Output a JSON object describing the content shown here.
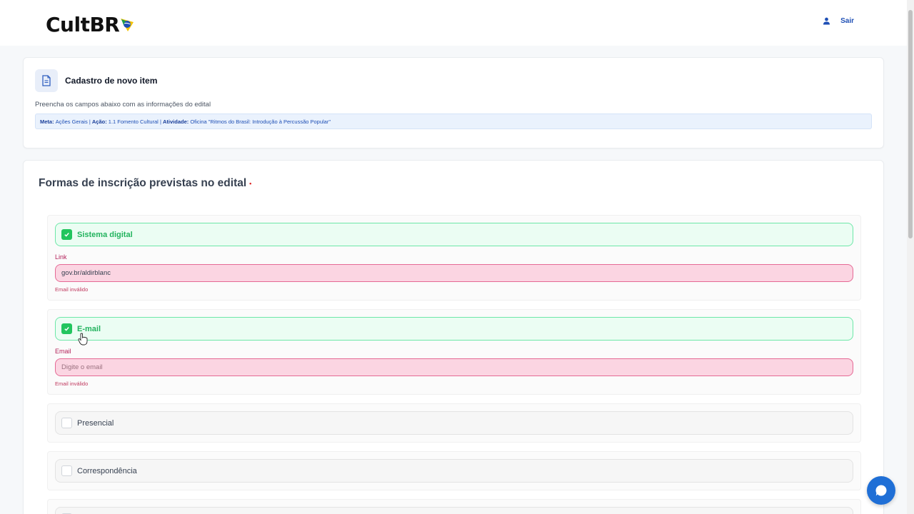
{
  "app": {
    "logo_text": "CultBR",
    "logout_label": "Sair",
    "colors": {
      "brand_blue": "#1e4fb5",
      "success_green": "#22c55e",
      "error_pink": "#e56a95"
    }
  },
  "header_card": {
    "title": "Cadastro de novo item",
    "description": "Preencha os campos abaixo com as informações do edital",
    "meta": {
      "meta_label": "Meta:",
      "meta_value": "Ações Gerais",
      "acao_label": "Ação:",
      "acao_value": "1.1 Fomento Cultural",
      "atividade_label": "Atividade:",
      "atividade_value": "Oficina \"Ritmos do Brasil: Introdução à Percussão Popular\"",
      "separator": "|"
    }
  },
  "form": {
    "section_title": "Formas de inscrição previstas no edital",
    "required_mark": "•",
    "options": [
      {
        "label": "Sistema digital",
        "checked": true,
        "field_label": "Link",
        "field_value": "gov.br/aldirblanc",
        "field_placeholder": "",
        "error": "Email inválido"
      },
      {
        "label": "E-mail",
        "checked": true,
        "field_label": "Email",
        "field_value": "",
        "field_placeholder": "Digite o email",
        "error": "Email inválido"
      },
      {
        "label": "Presencial",
        "checked": false
      },
      {
        "label": "Correspondência",
        "checked": false
      }
    ]
  },
  "icons": {
    "document": "document-icon",
    "user": "user-icon",
    "check": "check-icon",
    "chat": "chat-icon",
    "cursor": "hand-cursor-icon"
  }
}
